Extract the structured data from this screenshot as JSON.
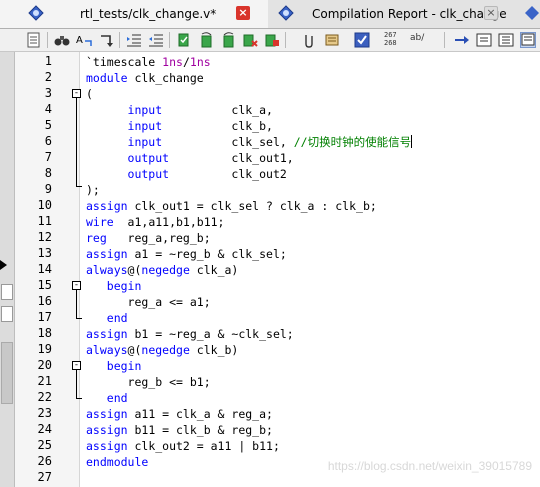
{
  "tabs": [
    {
      "label": "rtl_tests/clk_change.v*",
      "icon": "verilog-file-icon",
      "active": true
    },
    {
      "label": "Compilation Report - clk_change",
      "icon": "report-icon",
      "active": false
    }
  ],
  "toolbar": {
    "icons": [
      "page-icon",
      "binoculars-icon",
      "find-replace-icon",
      "goto-icon",
      "indent-icon",
      "unindent-icon",
      "bookmark-icon",
      "bookmark-next-icon",
      "bookmark-prev-icon",
      "bookmark-clear-icon",
      "bookmark-remove-icon",
      "attach-icon",
      "scroll-icon",
      "check-icon"
    ],
    "line_col_top": "267",
    "line_col_bottom": "268",
    "ab_label": "ab/",
    "right_icons": [
      "arrow-right-icon",
      "panel-icon",
      "panel-list-icon",
      "panel-active-icon"
    ]
  },
  "editor": {
    "line_numbers": [
      "1",
      "2",
      "3",
      "4",
      "5",
      "6",
      "7",
      "8",
      "9",
      "10",
      "11",
      "12",
      "13",
      "14",
      "15",
      "16",
      "17",
      "18",
      "19",
      "20",
      "21",
      "22",
      "23",
      "24",
      "25",
      "26",
      "27"
    ],
    "lines": [
      {
        "segments": [
          {
            "t": "`timescale ",
            "c": ""
          },
          {
            "t": "1ns",
            "c": "mg"
          },
          {
            "t": "/",
            "c": ""
          },
          {
            "t": "1ns",
            "c": "mg"
          }
        ]
      },
      {
        "segments": [
          {
            "t": "module ",
            "c": "kw"
          },
          {
            "t": "clk_change",
            "c": ""
          }
        ]
      },
      {
        "segments": [
          {
            "t": "(",
            "c": ""
          }
        ]
      },
      {
        "segments": [
          {
            "t": "      input          ",
            "c": "kw"
          },
          {
            "t": "clk_a,",
            "c": ""
          }
        ]
      },
      {
        "segments": [
          {
            "t": "      input          ",
            "c": "kw"
          },
          {
            "t": "clk_b,",
            "c": ""
          }
        ]
      },
      {
        "segments": [
          {
            "t": "      input          ",
            "c": "kw"
          },
          {
            "t": "clk_sel, ",
            "c": ""
          },
          {
            "t": "//切换时钟的使能信号",
            "c": "cm"
          }
        ]
      },
      {
        "segments": [
          {
            "t": "      output         ",
            "c": "kw"
          },
          {
            "t": "clk_out1,",
            "c": ""
          }
        ]
      },
      {
        "segments": [
          {
            "t": "      output         ",
            "c": "kw"
          },
          {
            "t": "clk_out2",
            "c": ""
          }
        ]
      },
      {
        "segments": [
          {
            "t": ");",
            "c": ""
          }
        ]
      },
      {
        "segments": [
          {
            "t": "assign ",
            "c": "kw"
          },
          {
            "t": "clk_out1 = clk_sel ? clk_a : clk_b;",
            "c": ""
          }
        ]
      },
      {
        "segments": [
          {
            "t": "wire  ",
            "c": "kw"
          },
          {
            "t": "a1,a11,b1,b11;",
            "c": ""
          }
        ]
      },
      {
        "segments": [
          {
            "t": "reg   ",
            "c": "kw"
          },
          {
            "t": "reg_a,reg_b;",
            "c": ""
          }
        ]
      },
      {
        "segments": [
          {
            "t": "assign ",
            "c": "kw"
          },
          {
            "t": "a1 = ~reg_b & clk_sel;",
            "c": ""
          }
        ]
      },
      {
        "segments": [
          {
            "t": "always",
            "c": "kw"
          },
          {
            "t": "@(",
            "c": ""
          },
          {
            "t": "negedge ",
            "c": "kw"
          },
          {
            "t": "clk_a)",
            "c": ""
          }
        ]
      },
      {
        "segments": [
          {
            "t": "   begin",
            "c": "kw"
          }
        ]
      },
      {
        "segments": [
          {
            "t": "      reg_a <= a1;",
            "c": ""
          }
        ]
      },
      {
        "segments": [
          {
            "t": "   end",
            "c": "kw"
          }
        ]
      },
      {
        "segments": [
          {
            "t": "assign ",
            "c": "kw"
          },
          {
            "t": "b1 = ~reg_a & ~clk_sel;",
            "c": ""
          }
        ]
      },
      {
        "segments": [
          {
            "t": "always",
            "c": "kw"
          },
          {
            "t": "@(",
            "c": ""
          },
          {
            "t": "negedge ",
            "c": "kw"
          },
          {
            "t": "clk_b)",
            "c": ""
          }
        ]
      },
      {
        "segments": [
          {
            "t": "   begin",
            "c": "kw"
          }
        ]
      },
      {
        "segments": [
          {
            "t": "      reg_b <= b1;",
            "c": ""
          }
        ]
      },
      {
        "segments": [
          {
            "t": "   end",
            "c": "kw"
          }
        ]
      },
      {
        "segments": [
          {
            "t": "assign ",
            "c": "kw"
          },
          {
            "t": "a11 = clk_a & reg_a;",
            "c": ""
          }
        ]
      },
      {
        "segments": [
          {
            "t": "assign ",
            "c": "kw"
          },
          {
            "t": "b11 = clk_b & reg_b;",
            "c": ""
          }
        ]
      },
      {
        "segments": [
          {
            "t": "assign ",
            "c": "kw"
          },
          {
            "t": "clk_out2 = a11 | b11;",
            "c": ""
          }
        ]
      },
      {
        "segments": [
          {
            "t": "endmodule",
            "c": "kw"
          }
        ]
      },
      {
        "segments": []
      }
    ],
    "cursor_line": 6
  },
  "watermark": "https://blog.csdn.net/weixin_39015789"
}
